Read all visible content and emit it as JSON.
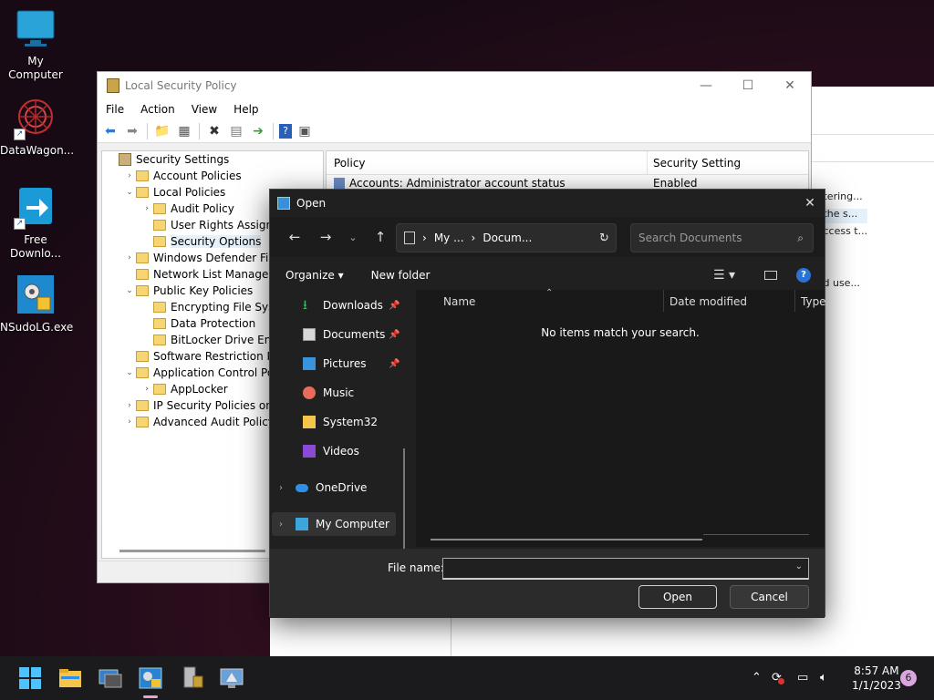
{
  "desktop": {
    "icons": [
      {
        "label": "My Computer"
      },
      {
        "label": "DataWagon..."
      },
      {
        "label": "Free Downlo..."
      },
      {
        "label": "NSudoLG.exe"
      }
    ]
  },
  "lsp_window": {
    "title": "Local Security Policy",
    "menu": [
      "File",
      "Action",
      "View",
      "Help"
    ],
    "tree": [
      {
        "label": "Security Settings",
        "indent": 0,
        "toggle": ""
      },
      {
        "label": "Account Policies",
        "indent": 1,
        "toggle": ">"
      },
      {
        "label": "Local Policies",
        "indent": 1,
        "toggle": "v"
      },
      {
        "label": "Audit Policy",
        "indent": 2,
        "toggle": ">"
      },
      {
        "label": "User Rights Assignme",
        "indent": 2,
        "toggle": ""
      },
      {
        "label": "Security Options",
        "indent": 2,
        "toggle": "",
        "selected": true
      },
      {
        "label": "Windows Defender Firew",
        "indent": 1,
        "toggle": ">"
      },
      {
        "label": "Network List Manager Po",
        "indent": 1,
        "toggle": ""
      },
      {
        "label": "Public Key Policies",
        "indent": 1,
        "toggle": "v"
      },
      {
        "label": "Encrypting File Syster",
        "indent": 2,
        "toggle": ""
      },
      {
        "label": "Data Protection",
        "indent": 2,
        "toggle": ""
      },
      {
        "label": "BitLocker Drive Encryp",
        "indent": 2,
        "toggle": ""
      },
      {
        "label": "Software Restriction Polic",
        "indent": 1,
        "toggle": ""
      },
      {
        "label": "Application Control Polic",
        "indent": 1,
        "toggle": "v"
      },
      {
        "label": "AppLocker",
        "indent": 2,
        "toggle": ">"
      },
      {
        "label": "IP Security Policies on Lo",
        "indent": 1,
        "toggle": ">"
      },
      {
        "label": "Advanced Audit Policy C",
        "indent": 1,
        "toggle": ">"
      }
    ],
    "columns": {
      "policy": "Policy",
      "setting": "Security Setting"
    },
    "rows": [
      {
        "policy": "Accounts: Administrator account status",
        "setting": "Enabled"
      }
    ]
  },
  "background_window_text": [
    "...tering...",
    "...the s...",
    "...ccess t...",
    "...d use..."
  ],
  "open_dialog": {
    "title": "Open",
    "address": {
      "seg1": "My ...",
      "seg2": "Docum..."
    },
    "search_placeholder": "Search Documents",
    "organize": "Organize",
    "new_folder": "New folder",
    "nav": [
      {
        "label": "Downloads",
        "pinned": true
      },
      {
        "label": "Documents",
        "pinned": true
      },
      {
        "label": "Pictures",
        "pinned": true
      },
      {
        "label": "Music",
        "pinned": false
      },
      {
        "label": "System32",
        "pinned": false
      },
      {
        "label": "Videos",
        "pinned": false
      },
      {
        "label": "OneDrive",
        "pinned": false
      },
      {
        "label": "My Computer",
        "pinned": false
      }
    ],
    "columns": {
      "name": "Name",
      "date": "Date modified",
      "type": "Type"
    },
    "empty_message": "No items match your search.",
    "file_name_label": "File name:",
    "file_name_value": "",
    "open_button": "Open",
    "cancel_button": "Cancel"
  },
  "taskbar": {
    "time": "8:57 AM",
    "date": "1/1/2023",
    "notification_count": "6"
  }
}
